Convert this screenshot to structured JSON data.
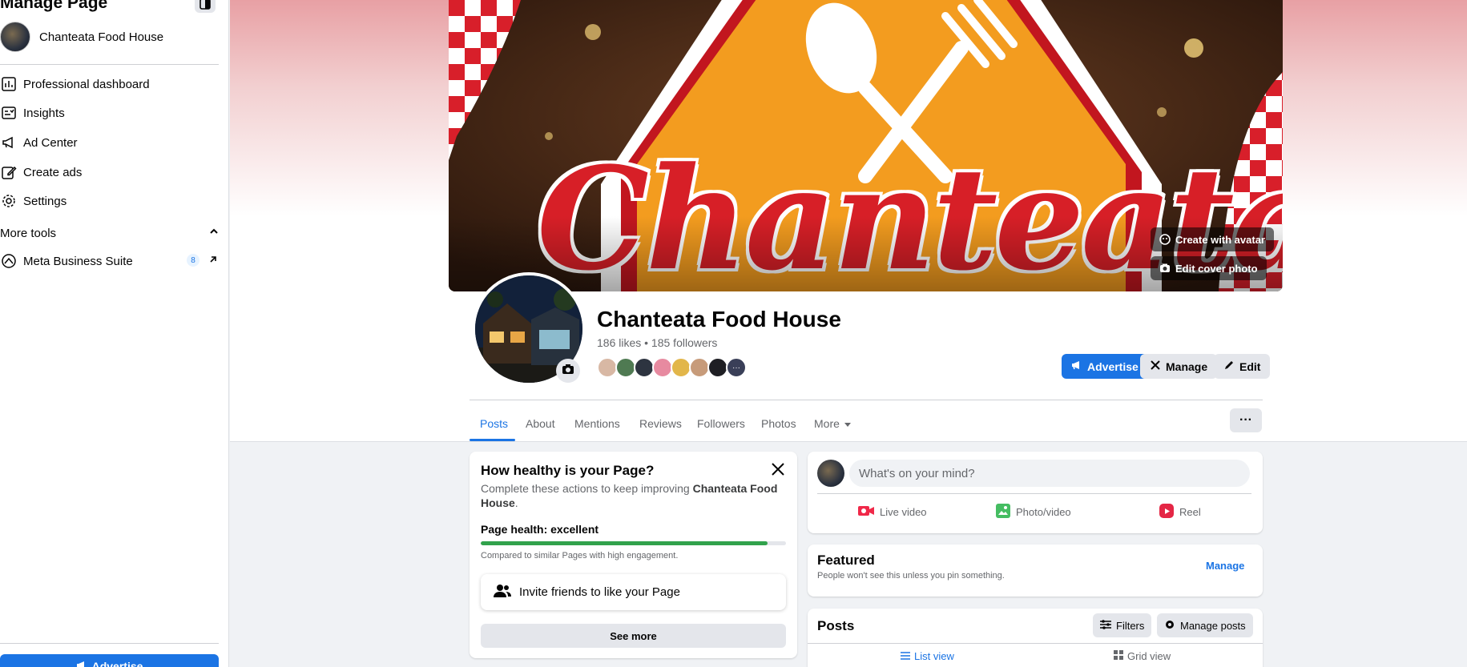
{
  "sidebar": {
    "title": "Manage Page",
    "page_name": "Chanteata Food House",
    "items": [
      {
        "label": "Professional dashboard",
        "icon": "dashboard-icon"
      },
      {
        "label": "Insights",
        "icon": "insights-icon"
      },
      {
        "label": "Ad Center",
        "icon": "megaphone-icon"
      },
      {
        "label": "Create ads",
        "icon": "pencil-icon"
      },
      {
        "label": "Settings",
        "icon": "gear-icon"
      }
    ],
    "more_tools_label": "More tools",
    "business_suite_label": "Meta Business Suite",
    "business_suite_badge": "8",
    "advertise_label": "Advertise"
  },
  "cover": {
    "logo_text": "Chanteata",
    "create_avatar_label": "Create with avatar",
    "edit_cover_label": "Edit cover photo"
  },
  "profile": {
    "name": "Chanteata Food House",
    "stats": "186 likes • 185 followers"
  },
  "actions": {
    "advertise": "Advertise",
    "manage": "Manage",
    "edit": "Edit"
  },
  "tabs": [
    {
      "label": "Posts",
      "active": true
    },
    {
      "label": "About"
    },
    {
      "label": "Mentions"
    },
    {
      "label": "Reviews"
    },
    {
      "label": "Followers"
    },
    {
      "label": "Photos"
    },
    {
      "label": "More"
    }
  ],
  "tabs_more_button": "···",
  "health": {
    "title": "How healthy is your Page?",
    "desc_prefix": "Complete these actions to keep improving ",
    "desc_page": "Chanteata Food House",
    "desc_suffix": ".",
    "label": "Page health: excellent",
    "progress": 0.94,
    "comparison": "Compared to similar Pages with high engagement.",
    "invite": "Invite friends to like your Page",
    "see_more": "See more"
  },
  "composer": {
    "placeholder": "What's on your mind?",
    "live_video": "Live video",
    "photo_video": "Photo/video",
    "reel": "Reel"
  },
  "featured": {
    "title": "Featured",
    "subtitle": "People won't see this unless you pin something.",
    "manage": "Manage"
  },
  "posts": {
    "title": "Posts",
    "filters": "Filters",
    "manage_posts": "Manage posts",
    "list_view": "List view",
    "grid_view": "Grid view"
  },
  "colors": {
    "accent": "#1b74e4",
    "health_bar": "#31a24c",
    "live_red": "#f02849",
    "photo_green": "#45bd62",
    "reel_pink": "#e42645"
  }
}
